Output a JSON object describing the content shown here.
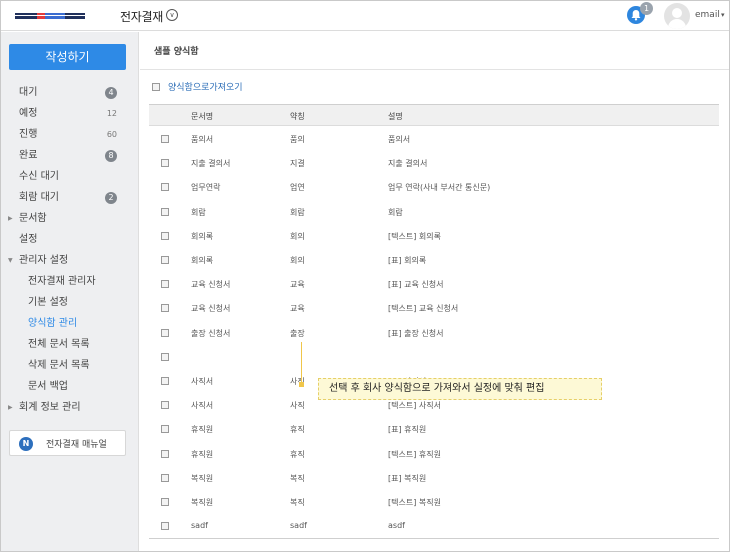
{
  "header": {
    "app_title": "전자결재",
    "notification_count": "1",
    "user_label": "email"
  },
  "sidebar": {
    "compose_label": "작성하기",
    "items": [
      {
        "label": "대기",
        "count": "4",
        "style": "pill"
      },
      {
        "label": "예정",
        "count": "12",
        "style": "plain"
      },
      {
        "label": "진행",
        "count": "60",
        "style": "plain"
      },
      {
        "label": "완료",
        "count": "8",
        "style": "pill"
      },
      {
        "label": "수신 대기",
        "count": "",
        "style": ""
      },
      {
        "label": "회람 대기",
        "count": "2",
        "style": "pill"
      },
      {
        "label": "문서함",
        "count": "",
        "style": "",
        "expandable": true
      },
      {
        "label": "설정",
        "count": "",
        "style": ""
      },
      {
        "label": "관리자 설정",
        "count": "",
        "style": "",
        "expanded": true
      }
    ],
    "admin_items": [
      {
        "label": "전자결재 관리자"
      },
      {
        "label": "기본 설정"
      },
      {
        "label": "양식함 관리",
        "active": true
      },
      {
        "label": "전체 문서 목록"
      },
      {
        "label": "삭제 문서 목록"
      },
      {
        "label": "문서 백업"
      }
    ],
    "accounting_label": "회계 정보 관리",
    "manual_label": "전자결재 매뉴얼"
  },
  "main": {
    "title": "샘플 양식함",
    "import_label": "양식함으로가져오기",
    "columns": [
      "문서명",
      "약칭",
      "설명"
    ],
    "rows": [
      [
        "품의서",
        "품의",
        "품의서"
      ],
      [
        "지출 결의서",
        "지결",
        "지출 결의서"
      ],
      [
        "업무연락",
        "업연",
        "업무 연락(사내 부서간 통신문)"
      ],
      [
        "회람",
        "회람",
        "회람"
      ],
      [
        "회의록",
        "회의",
        "[텍스트] 회의록"
      ],
      [
        "회의록",
        "회의",
        "[표] 회의록"
      ],
      [
        "교육 신청서",
        "교육",
        "[표] 교육 신청서"
      ],
      [
        "교육 신청서",
        "교육",
        "[텍스트] 교육 신청서"
      ],
      [
        "출장 신청서",
        "출장",
        "[표] 출장 신청서"
      ],
      [
        "",
        "",
        ""
      ],
      [
        "사직서",
        "사직",
        "[표] 사직서"
      ],
      [
        "사직서",
        "사직",
        "[텍스트] 사직서"
      ],
      [
        "휴직원",
        "휴직",
        "[표] 휴직원"
      ],
      [
        "휴직원",
        "휴직",
        "[텍스트] 휴직원"
      ],
      [
        "복직원",
        "복직",
        "[표] 복직원"
      ],
      [
        "복직원",
        "복직",
        "[텍스트] 복직원"
      ],
      [
        "sadf",
        "sadf",
        "asdf"
      ]
    ]
  },
  "callout": {
    "text": "선택 후 회사 양식함으로 가져와서 실정에 맞춰 편집"
  },
  "colors": {
    "accent": "#2e8ae6",
    "callout_bg": "#fdf9d6",
    "callout_line": "#f0c64a"
  }
}
